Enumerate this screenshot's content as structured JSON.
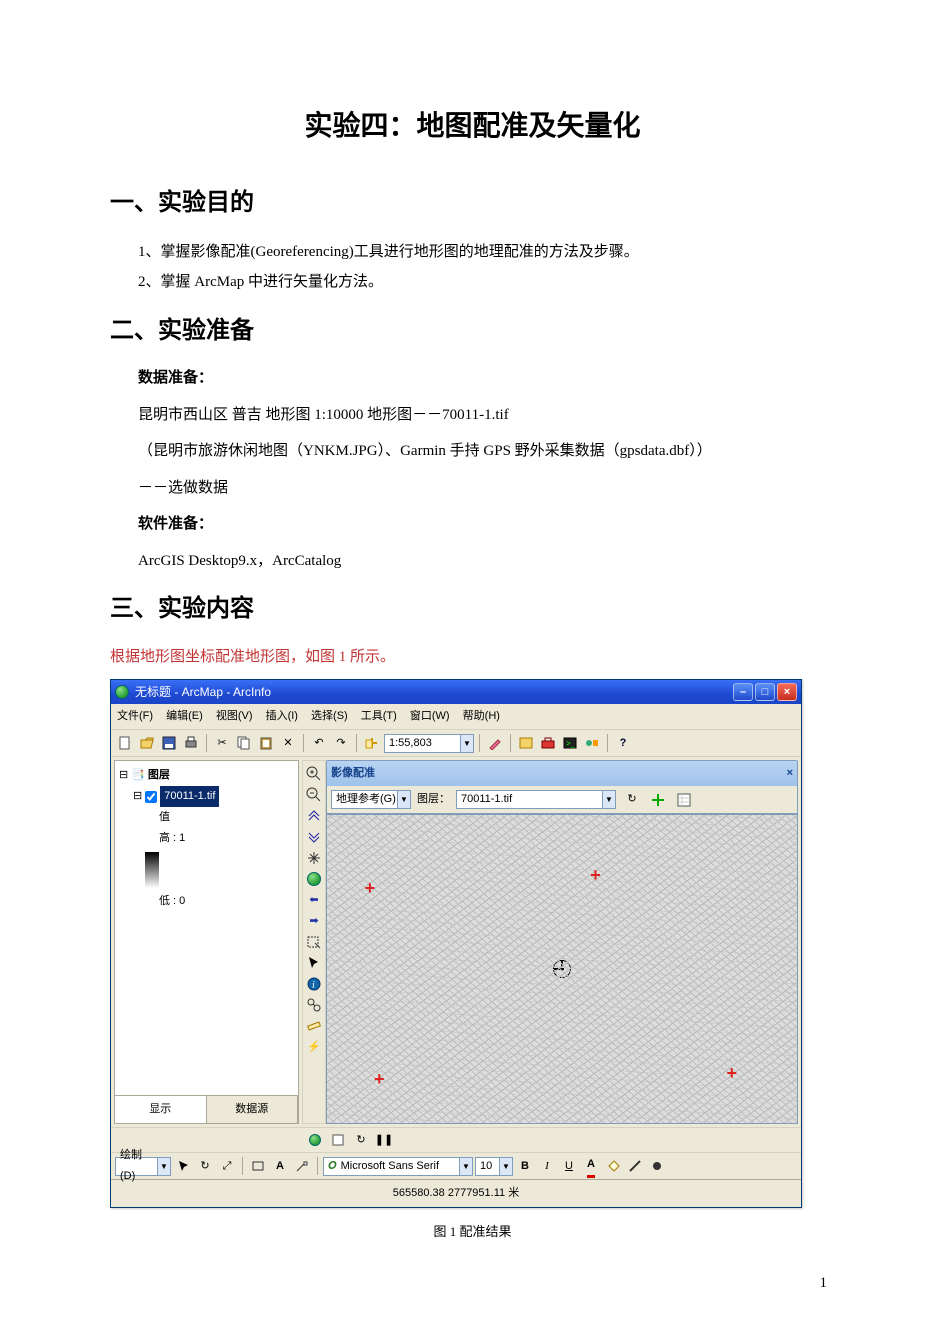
{
  "doc": {
    "title": "实验四：地图配准及矢量化",
    "s1_title": "一、实验目的",
    "s1_i1": "1、掌握影像配准(Georeferencing)工具进行地形图的地理配准的方法及步骤。",
    "s1_i2": "2、掌握 ArcMap 中进行矢量化方法。",
    "s2_title": "二、实验准备",
    "data_prep_label": "数据准备：",
    "data_prep_l1": "昆明市西山区 普吉 地形图 1:10000 地形图－－70011-1.tif",
    "data_prep_l2": "（昆明市旅游休闲地图（YNKM.JPG）、Garmin 手持 GPS 野外采集数据（gpsdata.dbf））",
    "data_prep_l3": "－－选做数据",
    "soft_prep_label": "软件准备：",
    "soft_prep_l1": "ArcGIS Desktop9.x，ArcCatalog",
    "s3_title": "三、实验内容",
    "s3_intro": "根据地形图坐标配准地形图，如图 1 所示。",
    "caption": "图 1 配准结果",
    "page_num": "1"
  },
  "win": {
    "title": "无标题 - ArcMap - ArcInfo",
    "menus": [
      "文件(F)",
      "编辑(E)",
      "视图(V)",
      "插入(I)",
      "选择(S)",
      "工具(T)",
      "窗口(W)",
      "帮助(H)"
    ],
    "scale": "1:55,803",
    "toc": {
      "root": "图层",
      "layer": "70011-1.tif",
      "value_label": "值",
      "high": "高 : 1",
      "low": "低 : 0",
      "tab_display": "显示",
      "tab_source": "数据源"
    },
    "georef": {
      "title": "影像配准",
      "ref_label": "地理参考(G)",
      "layer_label": "图层：",
      "layer_value": "70011-1.tif"
    },
    "draw": {
      "label": "绘制(D)",
      "font": "Microsoft Sans Serif",
      "size": "10"
    },
    "status_coords": "565580.38 2777951.11 米"
  }
}
